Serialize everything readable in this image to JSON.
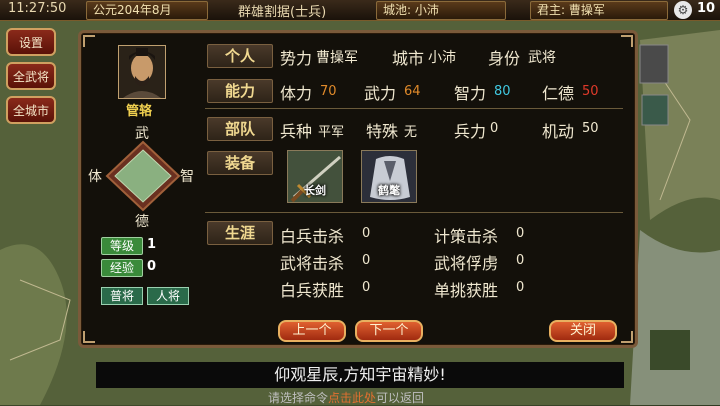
{
  "topbar": {
    "time": "11:27:50",
    "year_label": "公元204年8月",
    "mode": "群雄割据(士兵)",
    "city_label": "城池: 小沛",
    "ruler_label": "君主: 曹操军",
    "count": "10"
  },
  "side_buttons": [
    "设置",
    "全武将",
    "全城市"
  ],
  "general": {
    "name": "管辂",
    "axis": {
      "top": "武",
      "left": "体",
      "right": "智",
      "bottom": "德"
    },
    "level_label": "等级",
    "level": "1",
    "exp_label": "经验",
    "exp": "0",
    "rank1": "普将",
    "rank2": "人将"
  },
  "personal": {
    "section": "个人",
    "faction_label": "势力",
    "faction": "曹操军",
    "city_label": "城市",
    "city": "小沛",
    "identity_label": "身份",
    "identity": "武将"
  },
  "ability": {
    "section": "能力",
    "items": [
      {
        "label": "体力",
        "value": "70",
        "color": "#e08a2a"
      },
      {
        "label": "武力",
        "value": "64",
        "color": "#e08a2a"
      },
      {
        "label": "智力",
        "value": "80",
        "color": "#40c8e0"
      },
      {
        "label": "仁德",
        "value": "50",
        "color": "#e03a2a"
      }
    ]
  },
  "troops": {
    "section": "部队",
    "type_label": "兵种",
    "type": "平军",
    "special_label": "特殊",
    "special": "无",
    "strength_label": "兵力",
    "strength": "0",
    "mobility_label": "机动",
    "mobility": "50"
  },
  "equipment": {
    "section": "装备",
    "items": [
      "长剑",
      "鹤氅"
    ]
  },
  "career": {
    "section": "生涯",
    "items": [
      {
        "label": "白兵击杀",
        "value": "0"
      },
      {
        "label": "计策击杀",
        "value": "0"
      },
      {
        "label": "武将击杀",
        "value": "0"
      },
      {
        "label": "武将俘虏",
        "value": "0"
      },
      {
        "label": "白兵获胜",
        "value": "0"
      },
      {
        "label": "单挑获胜",
        "value": "0"
      }
    ]
  },
  "buttons": {
    "prev": "上一个",
    "next": "下一个",
    "close": "关闭"
  },
  "tip": "仰观星辰,方知宇宙精妙!",
  "hint": {
    "pre": "请选择命令",
    "highlight": "点击此处",
    "post": "可以返回"
  }
}
